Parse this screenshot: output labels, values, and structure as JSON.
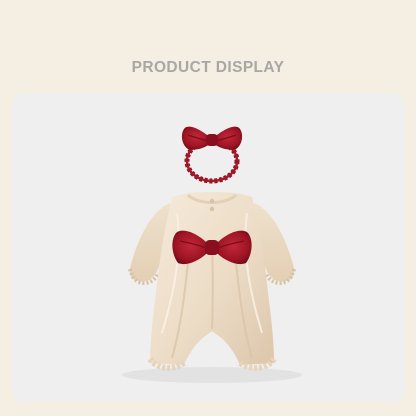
{
  "header": {
    "title": "PRODUCT DISPLAY"
  },
  "colors": {
    "page_background": "#f4efe2",
    "card_background": "#efefef",
    "title_text": "#a9a7a4",
    "romper_fabric": "#ecdcc6",
    "bow_red": "#9e1424"
  },
  "product_image": {
    "items": [
      "headband-with-red-bow",
      "cream-romper-with-red-bow"
    ]
  }
}
